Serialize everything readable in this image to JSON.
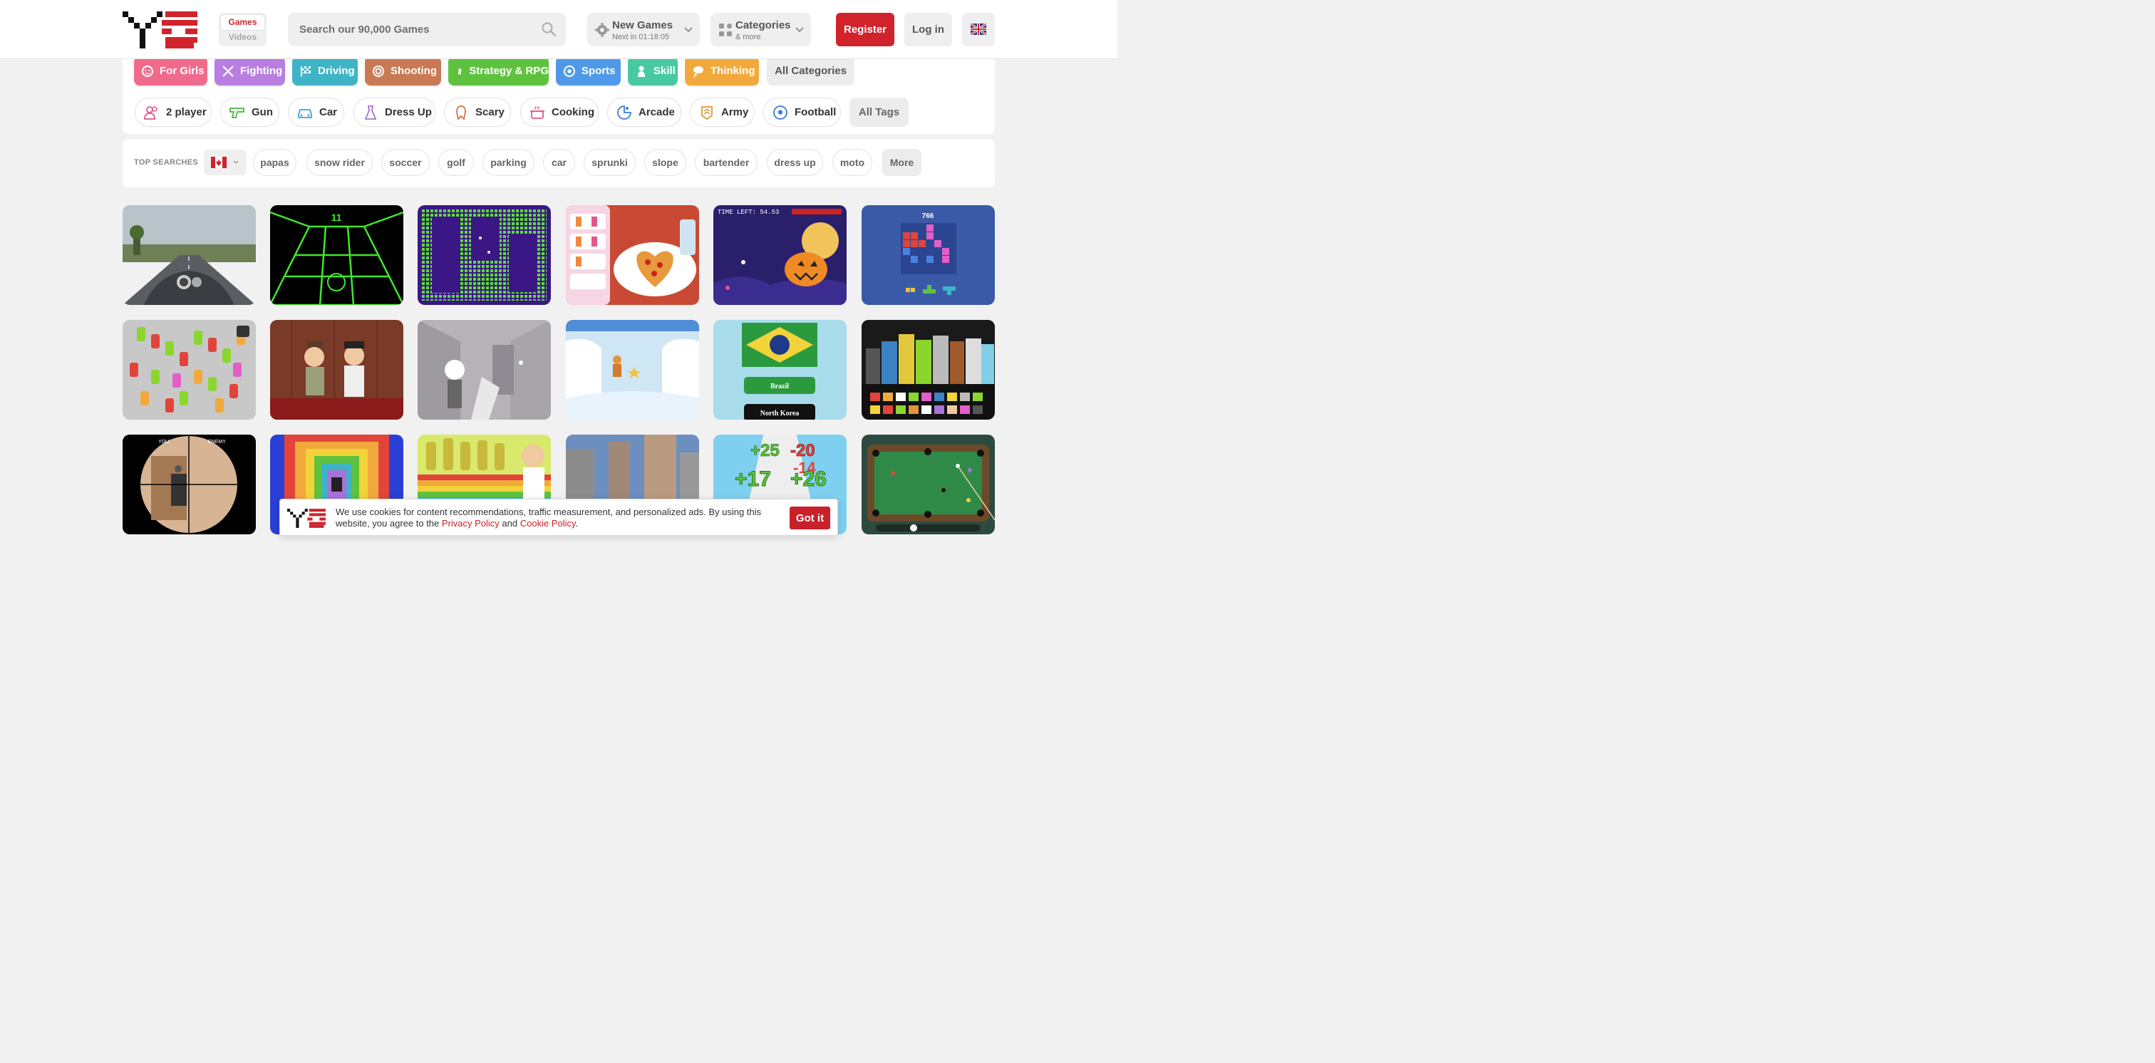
{
  "header": {
    "toggle": {
      "games_label": "Games",
      "videos_label": "Videos"
    },
    "search_placeholder": "Search our 90,000 Games",
    "new_games": {
      "title": "New Games",
      "subtitle": "Next in 01:18:05"
    },
    "categories_menu": {
      "title": "Categories",
      "subtitle": "& more"
    },
    "register_label": "Register",
    "login_label": "Log in",
    "language_icon": "uk-flag-icon"
  },
  "categories": [
    {
      "label": "For Girls",
      "color": "#f06b8b",
      "icon": "girl-face-icon"
    },
    {
      "label": "Fighting",
      "color": "#b87ee0",
      "icon": "crossed-swords-icon"
    },
    {
      "label": "Driving",
      "color": "#3fb4c7",
      "icon": "checkered-flag-icon"
    },
    {
      "label": "Shooting",
      "color": "#c97a55",
      "icon": "target-icon"
    },
    {
      "label": "Strategy & RPG",
      "color": "#5fc23f",
      "icon": "chess-piece-icon"
    },
    {
      "label": "Sports",
      "color": "#4f9ae8",
      "icon": "soccer-ball-icon"
    },
    {
      "label": "Skill",
      "color": "#48c9a1",
      "icon": "person-icon"
    },
    {
      "label": "Thinking",
      "color": "#f2a93b",
      "icon": "thought-bubble-icon"
    },
    {
      "label": "All Categories"
    }
  ],
  "tags": [
    {
      "label": "2 player",
      "icon": "two-players-icon"
    },
    {
      "label": "Gun",
      "icon": "gun-icon"
    },
    {
      "label": "Car",
      "icon": "car-icon"
    },
    {
      "label": "Dress Up",
      "icon": "dress-icon"
    },
    {
      "label": "Scary",
      "icon": "ghost-icon"
    },
    {
      "label": "Cooking",
      "icon": "cooking-pot-icon"
    },
    {
      "label": "Arcade",
      "icon": "arcade-icon"
    },
    {
      "label": "Army",
      "icon": "army-badge-icon"
    },
    {
      "label": "Football",
      "icon": "football-icon"
    },
    {
      "label": "All Tags"
    }
  ],
  "top_searches": {
    "label": "TOP SEARCHES",
    "flag_icon": "canada-flag-icon",
    "items": [
      "papas",
      "snow rider",
      "soccer",
      "golf",
      "parking",
      "car",
      "sprunki",
      "slope",
      "bartender",
      "dress up",
      "moto"
    ],
    "more_label": "More"
  },
  "game_thumbnails": {
    "row1": [
      "motorbike-road-thumbnail",
      "neon-slope-thumbnail",
      "pixel-maze-thumbnail",
      "pizza-cafe-thumbnail",
      "halloween-pumpkin-thumbnail",
      "block-puzzle-thumbnail"
    ],
    "row2": [
      "car-parking-jam-thumbnail",
      "gangsters-duel-thumbnail",
      "stickman-room-thumbnail",
      "snow-climber-thumbnail",
      "flag-quiz-thumbnail",
      "sprunki-characters-thumbnail"
    ],
    "row3": [
      "sniper-scope-thumbnail",
      "rainbow-tunnel-thumbnail",
      "bartender-thumbnail",
      "car-city-thumbnail",
      "math-runner-thumbnail",
      "pool-table-thumbnail"
    ],
    "game_text": {
      "slope_score": "11",
      "time_left": "TIME LEFT: 54.53",
      "block_score": "766",
      "flag_answer_1": "Brazil",
      "flag_answer_2": "North Korea",
      "sniper_you": "YOU",
      "sniper_enemy": "ENEMY",
      "math_plus": "+25",
      "math_minus": "-20",
      "math_a": "+17",
      "math_b": "+26",
      "math_c": "-14"
    }
  },
  "cookie": {
    "text_before": "We use cookies for content recommendations, traffic measurement, and personalized ads. By using this website, you agree to the ",
    "privacy_link": "Privacy Policy",
    "and_text": " and ",
    "cookie_link": "Cookie Policy",
    "end_text": ".",
    "button_label": "Got it"
  }
}
